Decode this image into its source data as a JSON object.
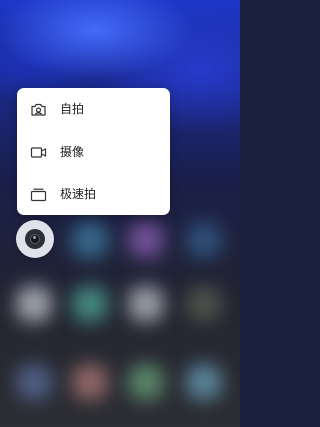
{
  "shortcut_menu": {
    "items": [
      {
        "label": "自拍",
        "icon": "selfie-camera-icon"
      },
      {
        "label": "摄像",
        "icon": "video-camera-icon"
      },
      {
        "label": "极速拍",
        "icon": "quick-shot-icon"
      }
    ]
  },
  "app": {
    "icon": "camera-app-icon"
  },
  "colors": {
    "popup_background": "#ffffff",
    "icon_stroke": "#333333",
    "text": "#222222"
  }
}
